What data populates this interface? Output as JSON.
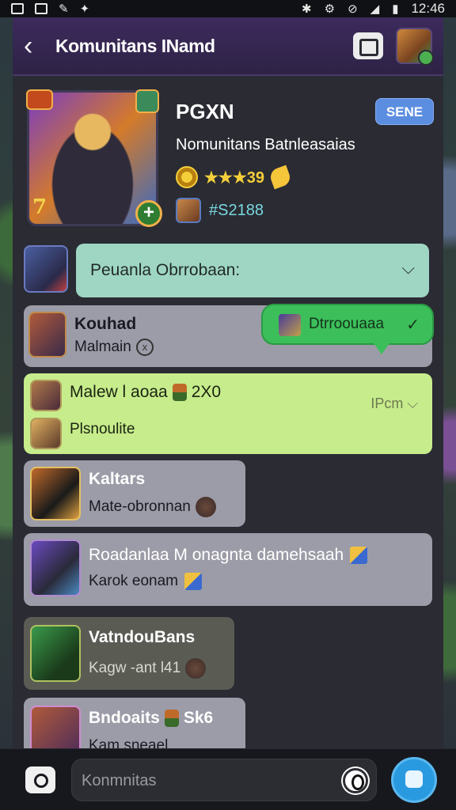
{
  "status_bar": {
    "time": "12:46"
  },
  "header": {
    "title": "Komunitans INamd",
    "back_icon": "chevron-left-icon",
    "window_icon": "window-icon"
  },
  "profile": {
    "name": "PGXN",
    "follow_label": "SENE",
    "subtitle": "Nomunitans Batnleasaias",
    "rating": "★★★39",
    "id_code": "#S2188"
  },
  "messages": {
    "filter": {
      "label": "Peuanla  Obrrobaan:",
      "caret": "⌵"
    },
    "row2": {
      "title": "Kouhad",
      "sub": "Malmain",
      "sub_badge": "x",
      "bubble": "Dtrroouaaa",
      "bubble_check": "✓"
    },
    "row3": {
      "title": "Malew  l aoaa",
      "title_suffix": "2X0",
      "sub": "Plsnoulite",
      "time": "IPcm ⌵"
    },
    "row4": {
      "title": "Kaltars",
      "sub": "Mate-obronnan"
    },
    "row5": {
      "title": "Roadanlaa M  onagnta damehsaah",
      "sub": "Karok  eonam"
    },
    "row6": {
      "title": "VatndouBans",
      "sub": "Kagw -ant l41"
    },
    "row7": {
      "title": "Bndoaits",
      "title_suffix": "Sk6",
      "sub": "Kam  sneael"
    }
  },
  "composer": {
    "placeholder": "Konmnitas"
  },
  "colors": {
    "accent_header": "#3c2a5c",
    "follow_button": "#5b8de0",
    "bubble_green": "#3cbf5a",
    "highlight_row": "#c7ec8c",
    "teal_row": "#9fd5c3",
    "send_button": "#2a9ae0"
  }
}
